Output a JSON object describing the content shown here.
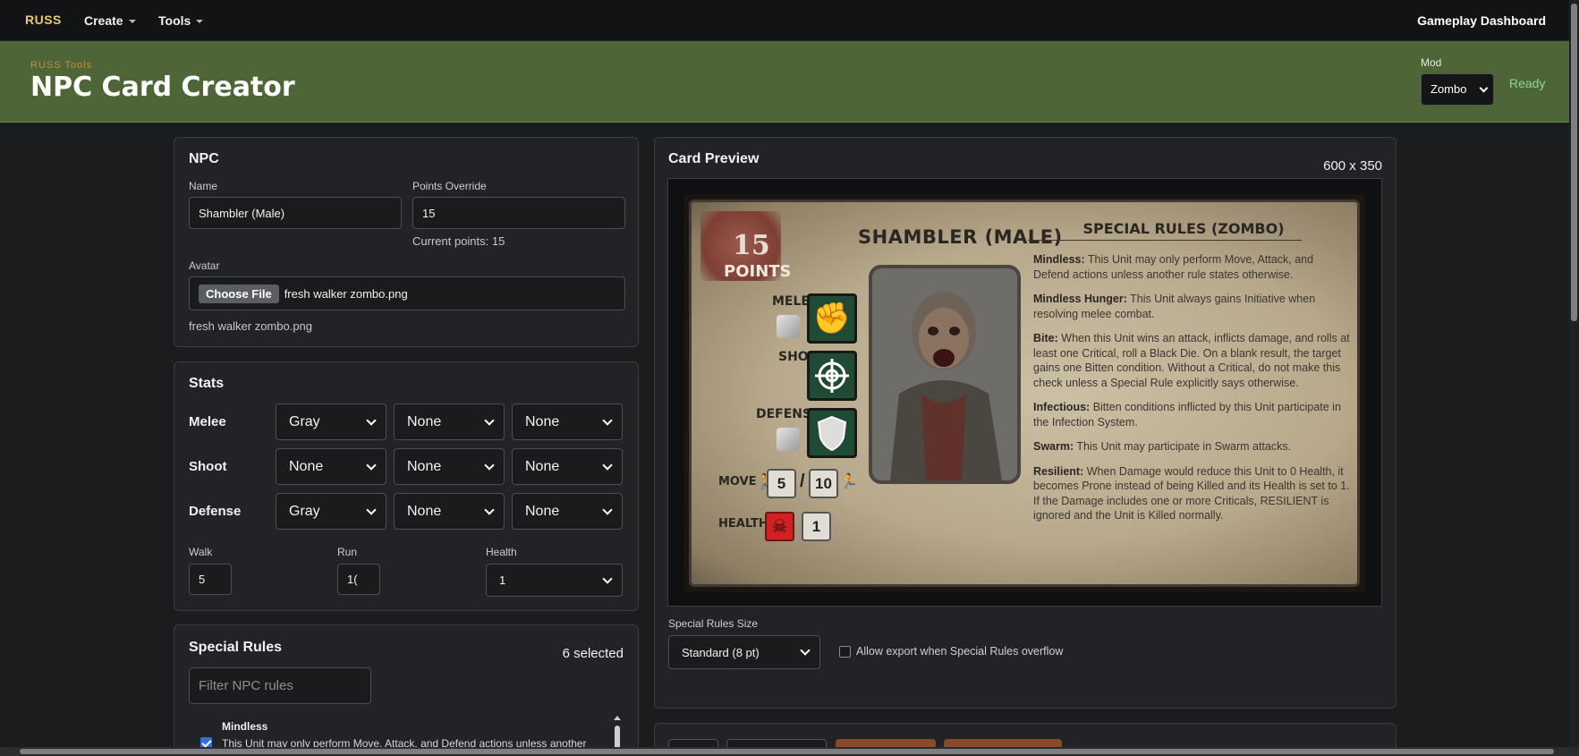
{
  "navbar": {
    "brand": "RUSS",
    "items": [
      {
        "label": "Create"
      },
      {
        "label": "Tools"
      }
    ],
    "right_link": "Gameplay Dashboard"
  },
  "header": {
    "breadcrumb": "RUSS Tools",
    "title": "NPC Card Creator",
    "mod_label": "Mod",
    "mod_value": "Zombo",
    "status": "Ready"
  },
  "npc": {
    "title": "NPC",
    "name_label": "Name",
    "name_value": "Shambler (Male)",
    "points_label": "Points Override",
    "points_value": "15",
    "current_points": "Current points: 15",
    "avatar_label": "Avatar",
    "file_button": "Choose File",
    "file_name": "fresh walker zombo.png",
    "file_caption": "fresh walker zombo.png"
  },
  "stats": {
    "title": "Stats",
    "rows": [
      {
        "name": "Melee",
        "values": [
          "Gray",
          "None",
          "None"
        ]
      },
      {
        "name": "Shoot",
        "values": [
          "None",
          "None",
          "None"
        ]
      },
      {
        "name": "Defense",
        "values": [
          "Gray",
          "None",
          "None"
        ]
      }
    ],
    "walk_label": "Walk",
    "walk_value": "5",
    "run_label": "Run",
    "run_value": "1(",
    "health_label": "Health",
    "health_value": "1"
  },
  "special_rules": {
    "title": "Special Rules",
    "count": "6 selected",
    "filter_placeholder": "Filter NPC rules",
    "items": [
      {
        "name": "Mindless",
        "desc": "This Unit may only perform Move, Attack, and Defend actions unless another",
        "checked": true
      }
    ]
  },
  "preview": {
    "title": "Card Preview",
    "size": "600 x 350",
    "rules_size_label": "Special Rules Size",
    "rules_size_value": "Standard (8 pt)",
    "overflow_label": "Allow export when Special Rules overflow"
  },
  "card": {
    "points": "15",
    "points_label": "POINTS",
    "name": "SHAMBLER (MALE)",
    "melee_label": "MELEE",
    "shoot_label": "SHOOT",
    "defense_label": "DEFENSE",
    "move_label": "MOVE",
    "walk": "5",
    "slash": "/",
    "run": "10",
    "health_label": "HEALTH",
    "health": "1",
    "rules_title": "SPECIAL RULES (ZOMBO)",
    "rules": [
      {
        "name": "Mindless:",
        "text": "This Unit may only perform Move, Attack, and Defend actions unless another rule states otherwise."
      },
      {
        "name": "Mindless Hunger:",
        "text": "This Unit always gains Initiative when resolving melee combat."
      },
      {
        "name": "Bite:",
        "text": "When this Unit wins an attack, inflicts damage, and rolls at least one Critical, roll a Black Die. On a blank result, the target gains one Bitten condition. Without a Critical, do not make this check unless a Special Rule explicitly says otherwise."
      },
      {
        "name": "Infectious:",
        "text": "Bitten conditions inflicted by this Unit participate in the Infection System."
      },
      {
        "name": "Swarm:",
        "text": "This Unit may participate in Swarm attacks."
      },
      {
        "name": "Resilient:",
        "text": "When Damage would reduce this Unit to 0 Health, it becomes Prone instead of being Killed and its Health is set to 1. If the Damage includes one or more Criticals, RESILIENT is ignored and the Unit is Killed normally."
      }
    ]
  },
  "icons": {
    "melee": "fist-icon",
    "shoot": "crosshair-icon",
    "defense": "shield-icon",
    "health": "skull-icon",
    "walk": "walking-person-icon",
    "run": "running-person-icon"
  },
  "colors": {
    "header_bg": "#4e6637",
    "brand": "#e9c97a",
    "status": "#8fd48f",
    "stat_icon_bg": "#1f4a33",
    "health_red": "#d32121",
    "export_button": "#8a4a2a"
  }
}
